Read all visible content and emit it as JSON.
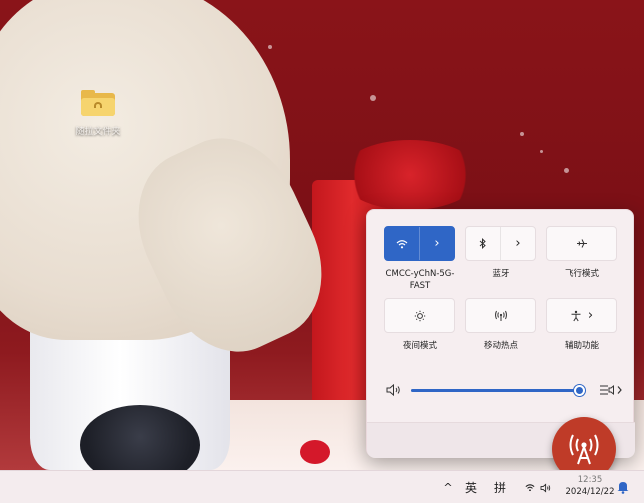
{
  "desktop": {
    "folder_label": "随拉文件夹"
  },
  "quick_settings": {
    "tiles": [
      {
        "id": "wifi",
        "label": "CMCC-yChN-5G-FAST",
        "active": true,
        "icon": "wifi-icon"
      },
      {
        "id": "bluetooth",
        "label": "蓝牙",
        "active": false,
        "icon": "bluetooth-icon"
      },
      {
        "id": "airplane",
        "label": "飞行模式",
        "active": false,
        "icon": "airplane-icon"
      },
      {
        "id": "night_light",
        "label": "夜间模式",
        "active": false,
        "icon": "brightness-icon"
      },
      {
        "id": "hotspot",
        "label": "移动热点",
        "active": false,
        "icon": "hotspot-icon"
      },
      {
        "id": "accessibility",
        "label": "辅助功能",
        "active": false,
        "icon": "accessibility-icon"
      }
    ],
    "volume": {
      "level": 0.99,
      "icon": "speaker-icon"
    },
    "audio_output_icon": "audio-output-icon"
  },
  "taskbar": {
    "tray_chevron": "^",
    "ime_lang": "英",
    "ime_mode": "拼",
    "clock_time": "12:35",
    "clock_date": "2024/12/22"
  },
  "colors": {
    "accent": "#2f66c6",
    "badge": "#bf3b28",
    "panel": "#f6eef0",
    "taskbar": "#f4ecee"
  }
}
